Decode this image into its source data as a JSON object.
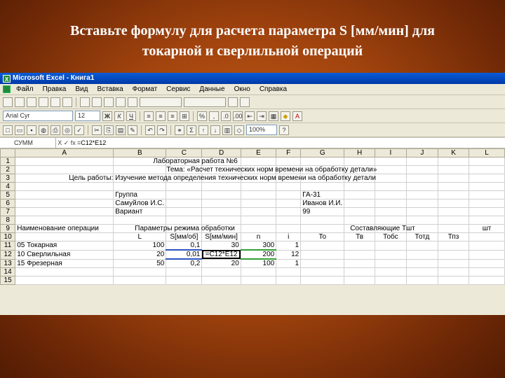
{
  "slide": {
    "title_line1": "Вставьте формулу для расчета параметра S [мм/мин] для",
    "title_line2": "токарной и сверлильной операций"
  },
  "window": {
    "title": "Microsoft Excel - Книга1"
  },
  "menu": [
    "Файл",
    "Правка",
    "Вид",
    "Вставка",
    "Формат",
    "Сервис",
    "Данные",
    "Окно",
    "Справка"
  ],
  "toolbar2": {
    "font_name": "Arial Cyr",
    "font_size": "12",
    "zoom": "100%"
  },
  "formula_bar": {
    "name_box": "СУММ",
    "fx": "X ✓ fx",
    "formula": "=C12*E12"
  },
  "columns": [
    "A",
    "B",
    "C",
    "D",
    "E",
    "F",
    "G",
    "H",
    "I",
    "J",
    "K",
    "L"
  ],
  "rows": [
    {
      "n": "1",
      "d": "Лабораторная работа №6"
    },
    {
      "n": "2",
      "d": "Тема: «Расчет технических норм времени на обработку детали»"
    },
    {
      "n": "3",
      "d": "Цель работы: Изучение метода определения технических норм времени на обработку детали"
    },
    {
      "n": "4",
      "d": ""
    },
    {
      "n": "5",
      "b": "Группа",
      "g": "ГА-31"
    },
    {
      "n": "6",
      "b": "Самуйлов И.С.",
      "g": "Иванов И.И."
    },
    {
      "n": "7",
      "b": "Вариант",
      "g": "99"
    },
    {
      "n": "8"
    },
    {
      "n": "9",
      "a": "Наименование операции",
      "params": "Параметры режима обработки",
      "comps": "Составляющие Тшт",
      "l": "шт"
    },
    {
      "n": "10",
      "b": "L",
      "c": "S[мм/об]",
      "d": "S[мм/мин]",
      "e": "n",
      "f": "i",
      "g": "To",
      "h": "Тв",
      "i": "Тобс",
      "j": "Тотд",
      "k": "Тпз"
    },
    {
      "n": "11",
      "a": "05 Токарная",
      "b": "100",
      "c": "0,1",
      "d": "30",
      "e": "300",
      "f": "1"
    },
    {
      "n": "12",
      "a": "10 Сверлильная",
      "b": "20",
      "c": "0,01",
      "d": "=C12*E12",
      "e": "200",
      "f": "12"
    },
    {
      "n": "13",
      "a": "15 Фрезерная",
      "b": "50",
      "c": "0,2",
      "d": "20",
      "e": "100",
      "f": "1"
    },
    {
      "n": "14"
    },
    {
      "n": "15"
    }
  ]
}
